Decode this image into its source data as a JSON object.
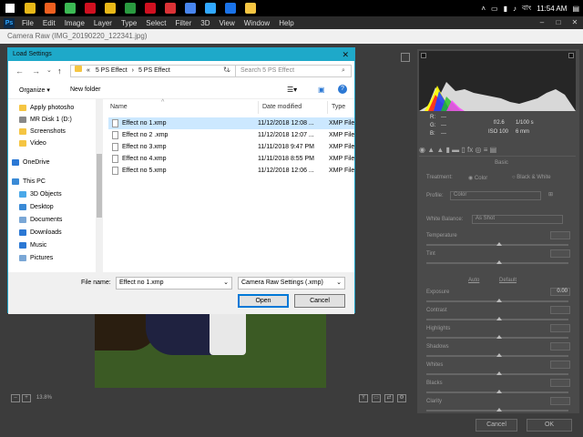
{
  "taskbar": {
    "apps": [
      {
        "name": "chrome-app",
        "color": "#e8b818"
      },
      {
        "name": "brave-app",
        "color": "#f06020"
      },
      {
        "name": "chrome-app-2",
        "color": "#3cba54"
      },
      {
        "name": "opera-app",
        "color": "#d01020"
      },
      {
        "name": "chrome-app-3",
        "color": "#e8b818"
      },
      {
        "name": "green-app",
        "color": "#2a9a40"
      },
      {
        "name": "opera-app-2",
        "color": "#d01020"
      },
      {
        "name": "chrome-app-4",
        "color": "#db3236"
      },
      {
        "name": "chrome-app-5",
        "color": "#4885ed"
      },
      {
        "name": "photoshop-app",
        "color": "#31a8ff"
      },
      {
        "name": "shield-app",
        "color": "#1a73e8"
      },
      {
        "name": "folder-app",
        "color": "#f5c542"
      }
    ],
    "clock": "11:54 AM",
    "lang": "বাং"
  },
  "ps_menu": [
    "File",
    "Edit",
    "Image",
    "Layer",
    "Type",
    "Select",
    "Filter",
    "3D",
    "View",
    "Window",
    "Help"
  ],
  "ps_logo": "Ps",
  "camera_raw": {
    "title": "Camera Raw (IMG_20190220_122341.jpg)",
    "zoom": "13.8%",
    "cancel_label": "Cancel",
    "ok_label": "OK",
    "info": {
      "r": "R:",
      "g": "G:",
      "b": "B:",
      "aperture": "f/2.6",
      "shutter": "1/100 s",
      "iso": "ISO 100",
      "focal": "6 mm",
      "r_val": "---",
      "g_val": "---",
      "b_val": "---"
    },
    "basic": {
      "section": "Basic",
      "treatment_label": "Treatment:",
      "color_opt": "Color",
      "bw_opt": "Black & White",
      "profile_label": "Profile:",
      "profile_value": "Color",
      "wb_label": "White Balance:",
      "wb_value": "As Shot",
      "auto": "Auto",
      "default": "Default",
      "sliders": [
        "Temperature",
        "Tint",
        "Exposure",
        "Contrast",
        "Highlights",
        "Shadows",
        "Whites",
        "Blacks",
        "Clarity"
      ],
      "exposure_value": "0.00"
    }
  },
  "dialog": {
    "title": "Load Settings",
    "breadcrumb_root": "«",
    "breadcrumb_1": "5 PS Effect",
    "breadcrumb_2": "5 PS Effect",
    "search_placeholder": "Search 5 PS Effect",
    "organize": "Organize ▾",
    "new_folder": "New folder",
    "nav": [
      {
        "label": "Apply photosho",
        "color": "#f5c542"
      },
      {
        "label": "MR Disk 1 (D:)",
        "color": "#888888"
      },
      {
        "label": "Screenshots",
        "color": "#f5c542"
      },
      {
        "label": "Video",
        "color": "#f5c542"
      },
      {
        "label": "OneDrive",
        "color": "#2b78d4"
      },
      {
        "label": "This PC",
        "color": "#3a8ad6"
      },
      {
        "label": "3D Objects",
        "color": "#4aa8e8"
      },
      {
        "label": "Desktop",
        "color": "#3a8ad6"
      },
      {
        "label": "Documents",
        "color": "#7aa7d6"
      },
      {
        "label": "Downloads",
        "color": "#2b78d4"
      },
      {
        "label": "Music",
        "color": "#2b78d4"
      },
      {
        "label": "Pictures",
        "color": "#7aa7d6"
      }
    ],
    "columns": {
      "name": "Name",
      "date": "Date modified",
      "type": "Type"
    },
    "files": [
      {
        "name": "Effect no 1.xmp",
        "date": "11/12/2018 12:08 ...",
        "type": "XMP File",
        "selected": true
      },
      {
        "name": "Effect no 2 .xmp",
        "date": "11/12/2018 12:07 ...",
        "type": "XMP File",
        "selected": false
      },
      {
        "name": "Effect no 3.xmp",
        "date": "11/11/2018 9:47 PM",
        "type": "XMP File",
        "selected": false
      },
      {
        "name": "Effect no 4.xmp",
        "date": "11/11/2018 8:55 PM",
        "type": "XMP File",
        "selected": false
      },
      {
        "name": "Effect no 5.xmp",
        "date": "11/12/2018 12:06 ...",
        "type": "XMP File",
        "selected": false
      }
    ],
    "filename_label": "File name:",
    "filename_value": "Effect no 1.xmp",
    "filetype_value": "Camera Raw Settings (.xmp)",
    "open_label": "Open",
    "cancel_label": "Cancel"
  }
}
